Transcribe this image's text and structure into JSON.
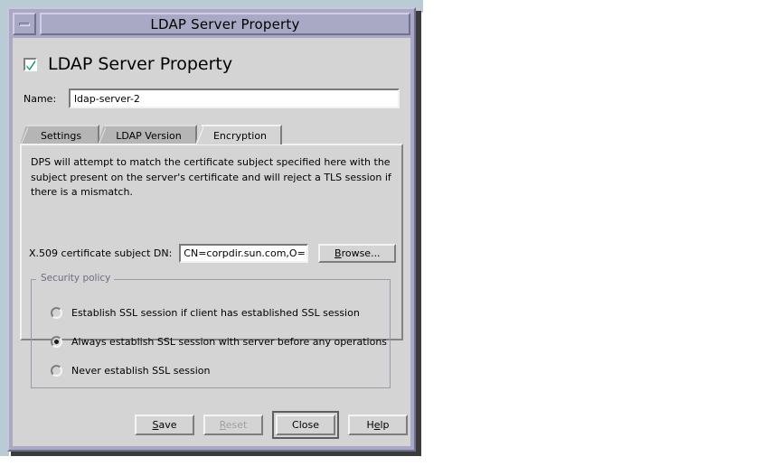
{
  "window": {
    "title": "LDAP Server Property",
    "minimize_icon": "minimize-icon"
  },
  "form": {
    "enable_checkbox_label": "LDAP Server Property",
    "enable_checkbox_checked": true,
    "check_icon": "check-icon",
    "name_label": "Name:",
    "name_value": "ldap-server-2",
    "name_placeholder": ""
  },
  "tabs": [
    {
      "label": "Settings",
      "active": false
    },
    {
      "label": "LDAP Version",
      "active": false
    },
    {
      "label": "Encryption",
      "active": true
    }
  ],
  "encryption_panel": {
    "description": "DPS will attempt to match the certificate subject specified here with the subject present on the server's certificate and will reject a TLS session if there is a mismatch.",
    "dn_label": "X.509 certificate subject DN:",
    "dn_value": "CN=corpdir.sun.com,O=",
    "dn_placeholder": "",
    "browse_label": "Browse...",
    "browse_mnemonic": "B"
  },
  "security_policy": {
    "legend": "Security policy",
    "options": [
      {
        "label": "Establish SSL session if client has established SSL session",
        "selected": false
      },
      {
        "label": "Always establish SSL session with server before any operations",
        "selected": true
      },
      {
        "label": "Never establish SSL session",
        "selected": false
      }
    ]
  },
  "buttons": [
    {
      "label": "Save",
      "mnemonic": "S",
      "disabled": false,
      "default": false
    },
    {
      "label": "Reset",
      "mnemonic": "R",
      "disabled": true,
      "default": false
    },
    {
      "label": "Close",
      "mnemonic": "",
      "disabled": false,
      "default": true
    },
    {
      "label": "Help",
      "mnemonic": "e",
      "disabled": false,
      "default": false
    }
  ],
  "colors": {
    "titlebar": "#a9a9c6",
    "client_bg": "#d4d4d4",
    "tab_inactive": "#b5b5b5",
    "check_green": "#009a6b",
    "shadow": "#3b3b3b",
    "desktop_strip": "#b9ccd6"
  }
}
